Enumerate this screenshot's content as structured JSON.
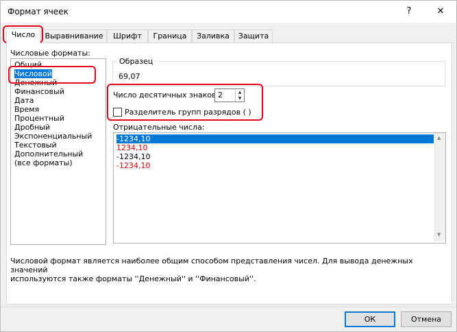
{
  "window": {
    "title": "Формат ячеек",
    "help_label": "?",
    "close_label": "✕"
  },
  "tabs": [
    {
      "label": "Число",
      "active": true
    },
    {
      "label": "Выравнивание"
    },
    {
      "label": "Шрифт"
    },
    {
      "label": "Граница"
    },
    {
      "label": "Заливка"
    },
    {
      "label": "Защита"
    }
  ],
  "formats": {
    "label": "Числовые форматы:",
    "items": [
      "Общий",
      "Числовой",
      "Денежный",
      "Финансовый",
      "Дата",
      "Время",
      "Процентный",
      "Дробный",
      "Экспоненциальный",
      "Текстовый",
      "Дополнительный",
      "(все форматы)"
    ],
    "selected": "Числовой"
  },
  "sample": {
    "label": "Образец",
    "value": "69,07"
  },
  "decimals": {
    "label": "Число десятичных знаков:",
    "value": "2"
  },
  "separator": {
    "label": "Разделитель групп разрядов ( )",
    "checked": false
  },
  "negative": {
    "label": "Отрицательные числа:",
    "items": [
      {
        "text": "-1234,10",
        "color": "#000000",
        "selected": true
      },
      {
        "text": "1234,10",
        "color": "#e00000"
      },
      {
        "text": "-1234,10",
        "color": "#000000"
      },
      {
        "text": "-1234,10",
        "color": "#e00000"
      }
    ]
  },
  "description": {
    "line1": "Числовой формат является наиболее общим способом представления чисел. Для вывода денежных значений",
    "line2": "используются также форматы ''Денежный'' и ''Финансовый''."
  },
  "buttons": {
    "ok": "ОК",
    "cancel": "Отмена"
  },
  "colors": {
    "accent": "#0078d7",
    "highlight": "#e0001a",
    "negative_red": "#e00000"
  }
}
